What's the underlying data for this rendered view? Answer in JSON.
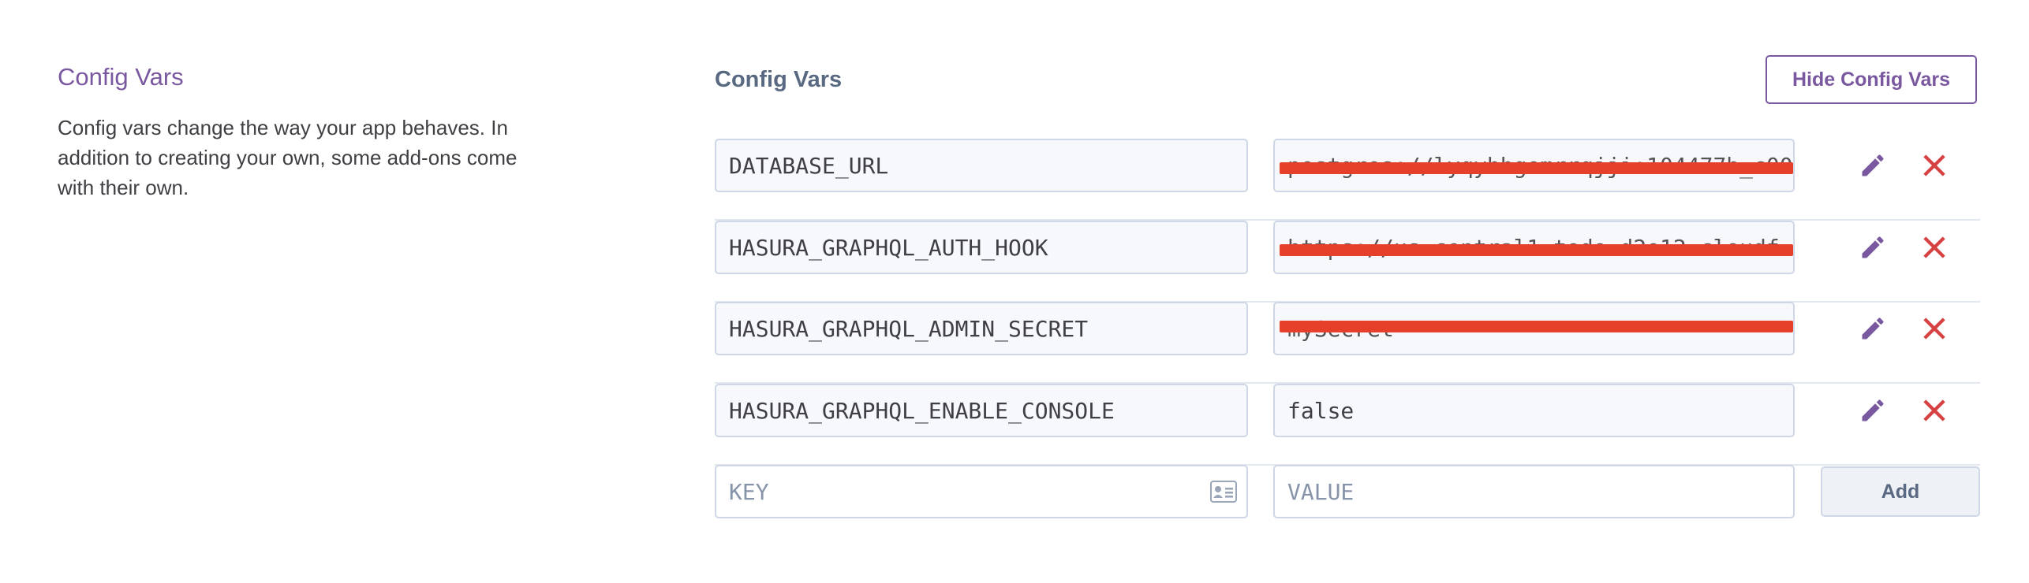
{
  "sidebar": {
    "title": "Config Vars",
    "description": "Config vars change the way your app behaves. In addition to creating your own, some add-ons come with their own."
  },
  "main": {
    "title": "Config Vars",
    "hide_button_label": "Hide Config Vars",
    "vars": [
      {
        "key": "DATABASE_URL",
        "value": "postgres://lyqyhhgemrrqjji:104477b_c00",
        "redacted": true
      },
      {
        "key": "HASURA_GRAPHQL_AUTH_HOOK",
        "value": "https://us-central1-todo-d2e12.cloudf",
        "redacted": true
      },
      {
        "key": "HASURA_GRAPHQL_ADMIN_SECRET",
        "value": "mySecret",
        "redacted": true
      },
      {
        "key": "HASURA_GRAPHQL_ENABLE_CONSOLE",
        "value": "false",
        "redacted": false
      }
    ],
    "new_var": {
      "key_placeholder": "KEY",
      "value_placeholder": "VALUE",
      "add_label": "Add"
    }
  },
  "colors": {
    "accent": "#79589f",
    "delete": "#d64242",
    "redaction": "#e6402a"
  },
  "icons": {
    "edit": "pencil-icon",
    "delete": "close-icon",
    "key_field": "id-card-icon"
  }
}
